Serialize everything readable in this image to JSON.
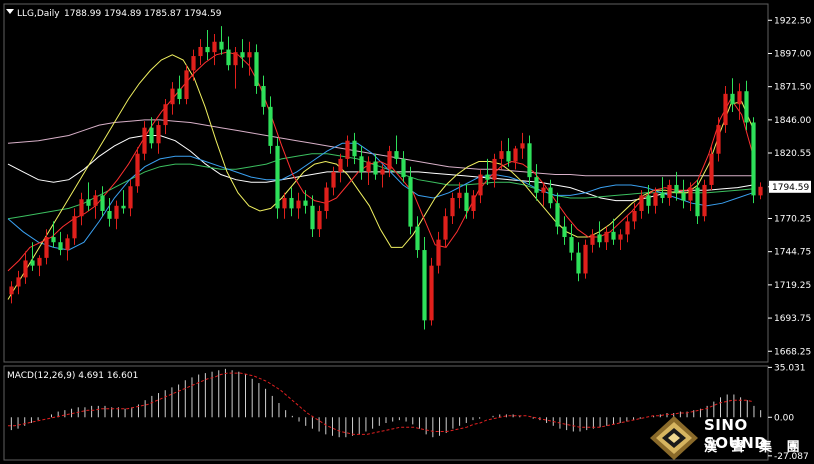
{
  "header": {
    "symbol": "LLG,Daily",
    "ohlc": "1788.99 1794.89 1785.87 1794.59",
    "menu_icon": "triangle-down-icon"
  },
  "macd_label": "MACD(12,26,9) 4.691 16.601",
  "brand": {
    "name": "SINO SOUND",
    "chinese": "漢 聲 集 團",
    "logo_icon": "diamond-logo-icon"
  },
  "colors": {
    "up_candle": "#e0201c",
    "down_candle": "#2ee05a",
    "ma_yellow": "#f0f060",
    "ma_fast_red": "#ff3030",
    "ma_white": "#ffffff",
    "ma_blue": "#3aa0f0",
    "ma_green": "#3cc060",
    "ma_pink": "#d8b0c8",
    "macd_hist": "#d0d0d0",
    "macd_signal": "#e02020",
    "current_price_box": "#ffffff"
  },
  "chart_data": [
    {
      "type": "candlestick",
      "title": "LLG,Daily",
      "current_price": 1794.59,
      "ylim": [
        1660,
        1935
      ],
      "y_ticks": [
        "1922.50",
        "1897.00",
        "1871.50",
        "1846.00",
        "1820.55",
        "1794.59",
        "1770.25",
        "1744.75",
        "1719.25",
        "1693.75",
        "1668.25"
      ],
      "y_tick_values": [
        1922.5,
        1897.0,
        1871.5,
        1846.0,
        1820.55,
        1794.59,
        1770.25,
        1744.75,
        1719.25,
        1693.75,
        1668.25
      ],
      "candles": [
        [
          1712,
          1722,
          1705,
          1718
        ],
        [
          1718,
          1730,
          1712,
          1725
        ],
        [
          1725,
          1745,
          1720,
          1738
        ],
        [
          1738,
          1752,
          1730,
          1734
        ],
        [
          1734,
          1742,
          1726,
          1740
        ],
        [
          1740,
          1762,
          1735,
          1756
        ],
        [
          1756,
          1768,
          1748,
          1752
        ],
        [
          1752,
          1760,
          1742,
          1746
        ],
        [
          1746,
          1758,
          1738,
          1755
        ],
        [
          1755,
          1778,
          1750,
          1772
        ],
        [
          1772,
          1790,
          1765,
          1785
        ],
        [
          1785,
          1798,
          1776,
          1780
        ],
        [
          1780,
          1792,
          1770,
          1788
        ],
        [
          1788,
          1795,
          1772,
          1776
        ],
        [
          1776,
          1786,
          1764,
          1770
        ],
        [
          1770,
          1784,
          1762,
          1780
        ],
        [
          1780,
          1792,
          1774,
          1778
        ],
        [
          1778,
          1800,
          1772,
          1795
        ],
        [
          1795,
          1825,
          1790,
          1820
        ],
        [
          1820,
          1845,
          1815,
          1840
        ],
        [
          1840,
          1848,
          1824,
          1828
        ],
        [
          1828,
          1845,
          1820,
          1842
        ],
        [
          1842,
          1862,
          1835,
          1858
        ],
        [
          1858,
          1875,
          1850,
          1870
        ],
        [
          1870,
          1880,
          1858,
          1862
        ],
        [
          1862,
          1888,
          1858,
          1884
        ],
        [
          1884,
          1900,
          1876,
          1895
        ],
        [
          1895,
          1908,
          1888,
          1902
        ],
        [
          1902,
          1915,
          1892,
          1898
        ],
        [
          1898,
          1912,
          1888,
          1906
        ],
        [
          1906,
          1918,
          1896,
          1900
        ],
        [
          1900,
          1910,
          1884,
          1888
        ],
        [
          1888,
          1902,
          1870,
          1898
        ],
        [
          1898,
          1908,
          1886,
          1894
        ],
        [
          1894,
          1906,
          1880,
          1898
        ],
        [
          1898,
          1904,
          1866,
          1872
        ],
        [
          1872,
          1880,
          1850,
          1856
        ],
        [
          1856,
          1864,
          1820,
          1826
        ],
        [
          1826,
          1832,
          1770,
          1778
        ],
        [
          1778,
          1790,
          1770,
          1786
        ],
        [
          1786,
          1794,
          1772,
          1778
        ],
        [
          1778,
          1790,
          1770,
          1784
        ],
        [
          1784,
          1792,
          1774,
          1780
        ],
        [
          1780,
          1788,
          1756,
          1762
        ],
        [
          1762,
          1780,
          1756,
          1776
        ],
        [
          1776,
          1798,
          1770,
          1794
        ],
        [
          1794,
          1810,
          1788,
          1806
        ],
        [
          1806,
          1820,
          1798,
          1816
        ],
        [
          1816,
          1834,
          1810,
          1830
        ],
        [
          1830,
          1836,
          1812,
          1818
        ],
        [
          1818,
          1826,
          1800,
          1806
        ],
        [
          1806,
          1818,
          1796,
          1814
        ],
        [
          1814,
          1820,
          1800,
          1804
        ],
        [
          1804,
          1812,
          1794,
          1808
        ],
        [
          1808,
          1826,
          1802,
          1822
        ],
        [
          1822,
          1834,
          1812,
          1816
        ],
        [
          1816,
          1822,
          1798,
          1802
        ],
        [
          1802,
          1810,
          1758,
          1764
        ],
        [
          1764,
          1772,
          1740,
          1746
        ],
        [
          1746,
          1756,
          1685,
          1692
        ],
        [
          1692,
          1740,
          1688,
          1734
        ],
        [
          1734,
          1760,
          1728,
          1754
        ],
        [
          1754,
          1778,
          1748,
          1772
        ],
        [
          1772,
          1790,
          1766,
          1786
        ],
        [
          1786,
          1798,
          1778,
          1790
        ],
        [
          1790,
          1796,
          1770,
          1776
        ],
        [
          1776,
          1792,
          1770,
          1788
        ],
        [
          1788,
          1808,
          1782,
          1804
        ],
        [
          1804,
          1816,
          1796,
          1800
        ],
        [
          1800,
          1820,
          1794,
          1816
        ],
        [
          1816,
          1830,
          1808,
          1822
        ],
        [
          1822,
          1832,
          1810,
          1814
        ],
        [
          1814,
          1826,
          1808,
          1824
        ],
        [
          1824,
          1836,
          1816,
          1828
        ],
        [
          1828,
          1834,
          1796,
          1802
        ],
        [
          1802,
          1812,
          1784,
          1790
        ],
        [
          1790,
          1798,
          1780,
          1794
        ],
        [
          1794,
          1800,
          1778,
          1782
        ],
        [
          1782,
          1790,
          1758,
          1764
        ],
        [
          1764,
          1772,
          1750,
          1756
        ],
        [
          1756,
          1766,
          1738,
          1744
        ],
        [
          1744,
          1752,
          1722,
          1728
        ],
        [
          1728,
          1754,
          1724,
          1750
        ],
        [
          1750,
          1762,
          1744,
          1758
        ],
        [
          1758,
          1768,
          1748,
          1752
        ],
        [
          1752,
          1764,
          1746,
          1760
        ],
        [
          1760,
          1770,
          1750,
          1754
        ],
        [
          1754,
          1762,
          1746,
          1758
        ],
        [
          1758,
          1772,
          1752,
          1768
        ],
        [
          1768,
          1782,
          1762,
          1776
        ],
        [
          1776,
          1792,
          1770,
          1788
        ],
        [
          1788,
          1796,
          1774,
          1780
        ],
        [
          1780,
          1794,
          1774,
          1790
        ],
        [
          1790,
          1802,
          1782,
          1786
        ],
        [
          1786,
          1800,
          1780,
          1796
        ],
        [
          1796,
          1806,
          1784,
          1790
        ],
        [
          1790,
          1800,
          1778,
          1784
        ],
        [
          1784,
          1798,
          1776,
          1794
        ],
        [
          1794,
          1800,
          1766,
          1772
        ],
        [
          1772,
          1800,
          1768,
          1796
        ],
        [
          1796,
          1826,
          1792,
          1820
        ],
        [
          1820,
          1848,
          1814,
          1842
        ],
        [
          1842,
          1872,
          1836,
          1866
        ],
        [
          1866,
          1878,
          1852,
          1858
        ],
        [
          1858,
          1874,
          1846,
          1868
        ],
        [
          1868,
          1876,
          1838,
          1844
        ],
        [
          1844,
          1848,
          1782,
          1788
        ],
        [
          1788,
          1798,
          1785,
          1794.59
        ]
      ],
      "ma_fast_red": [
        1730,
        1738,
        1748,
        1752,
        1756,
        1764,
        1770,
        1774,
        1780,
        1790,
        1800,
        1812,
        1826,
        1840,
        1852,
        1862,
        1872,
        1882,
        1890,
        1896,
        1898,
        1896,
        1888,
        1872,
        1850,
        1826,
        1804,
        1790,
        1784,
        1782,
        1786,
        1796,
        1806,
        1812,
        1814,
        1810,
        1800,
        1790,
        1770,
        1750,
        1748,
        1760,
        1776,
        1792,
        1802,
        1810,
        1814,
        1812,
        1806,
        1796,
        1784,
        1772,
        1762,
        1756,
        1756,
        1760,
        1768,
        1776,
        1786,
        1792,
        1794,
        1792,
        1792,
        1800,
        1820,
        1846,
        1862,
        1850,
        1820
      ],
      "ma_yellow": [
        1708,
        1722,
        1736,
        1750,
        1764,
        1778,
        1792,
        1806,
        1820,
        1834,
        1848,
        1862,
        1874,
        1884,
        1892,
        1896,
        1892,
        1878,
        1856,
        1830,
        1806,
        1790,
        1780,
        1776,
        1778,
        1786,
        1796,
        1806,
        1812,
        1814,
        1812,
        1804,
        1792,
        1780,
        1762,
        1748,
        1748,
        1758,
        1772,
        1786,
        1796,
        1804,
        1810,
        1814,
        1814,
        1812,
        1806,
        1798,
        1788,
        1778,
        1768,
        1760,
        1756,
        1756,
        1760,
        1766,
        1774,
        1782,
        1788,
        1792,
        1792,
        1790,
        1790,
        1796,
        1812,
        1836,
        1858,
        1860,
        1840
      ],
      "ma_white": [
        1812,
        1806,
        1800,
        1798,
        1800,
        1808,
        1818,
        1826,
        1832,
        1834,
        1834,
        1830,
        1822,
        1812,
        1804,
        1800,
        1798,
        1798,
        1800,
        1802,
        1804,
        1806,
        1806,
        1806,
        1806,
        1806,
        1806,
        1806,
        1805,
        1804,
        1803,
        1802,
        1801,
        1800,
        1799,
        1798,
        1796,
        1794,
        1790,
        1786,
        1784,
        1784,
        1786,
        1789,
        1791,
        1792,
        1792,
        1793,
        1794,
        1796
      ],
      "ma_blue": [
        1770,
        1760,
        1752,
        1748,
        1746,
        1752,
        1768,
        1786,
        1800,
        1810,
        1816,
        1818,
        1818,
        1814,
        1810,
        1806,
        1802,
        1800,
        1800,
        1806,
        1814,
        1822,
        1828,
        1828,
        1820,
        1808,
        1796,
        1788,
        1786,
        1790,
        1796,
        1802,
        1804,
        1802,
        1798,
        1792,
        1788,
        1788,
        1790,
        1794,
        1796,
        1796,
        1794,
        1790,
        1786,
        1782,
        1780,
        1782,
        1786,
        1790
      ],
      "ma_green": [
        1770,
        1772,
        1774,
        1776,
        1778,
        1782,
        1788,
        1794,
        1800,
        1806,
        1810,
        1812,
        1812,
        1810,
        1808,
        1808,
        1810,
        1812,
        1816,
        1818,
        1820,
        1820,
        1818,
        1816,
        1812,
        1808,
        1804,
        1800,
        1798,
        1796,
        1796,
        1797,
        1798,
        1798,
        1796,
        1792,
        1788,
        1786,
        1786,
        1787,
        1788,
        1789,
        1790,
        1790,
        1790,
        1790,
        1790,
        1791,
        1792,
        1793
      ],
      "ma_pink": [
        1828,
        1829,
        1830,
        1832,
        1834,
        1838,
        1842,
        1844,
        1845,
        1846,
        1846,
        1845,
        1844,
        1842,
        1840,
        1838,
        1836,
        1834,
        1832,
        1830,
        1828,
        1826,
        1824,
        1822,
        1820,
        1818,
        1816,
        1814,
        1812,
        1810,
        1809,
        1808,
        1808,
        1807,
        1806,
        1805,
        1804,
        1804,
        1803,
        1803,
        1803,
        1803,
        1803,
        1803,
        1803,
        1803,
        1803,
        1803,
        1803,
        1803
      ]
    },
    {
      "type": "bar",
      "title": "MACD(12,26,9) 4.691 16.601",
      "ylim": [
        -30,
        36
      ],
      "y_ticks": [
        "35.031",
        "0.00",
        "-27.087"
      ],
      "y_tick_values": [
        35.031,
        0,
        -27.087
      ],
      "macd_hist": [
        -9,
        -8,
        -6,
        -4,
        -2,
        0,
        2,
        4,
        5,
        6,
        7,
        7,
        8,
        8,
        8,
        7,
        7,
        6,
        7,
        9,
        12,
        15,
        17,
        19,
        21,
        23,
        26,
        28,
        30,
        31,
        32,
        33,
        34,
        33,
        32,
        30,
        27,
        24,
        20,
        15,
        10,
        5,
        1,
        -3,
        -6,
        -8,
        -10,
        -12,
        -13,
        -14,
        -14,
        -13,
        -12,
        -10,
        -8,
        -6,
        -4,
        -3,
        -2,
        -3,
        -5,
        -8,
        -12,
        -14,
        -13,
        -11,
        -8,
        -6,
        -4,
        -2,
        -1,
        0,
        1,
        2,
        2,
        2,
        1,
        0,
        -1,
        -2,
        -4,
        -6,
        -8,
        -9,
        -10,
        -10,
        -9,
        -8,
        -7,
        -6,
        -5,
        -4,
        -3,
        -2,
        -1,
        0,
        1,
        2,
        3,
        3,
        4,
        4,
        5,
        6,
        8,
        11,
        14,
        16,
        16,
        14,
        12,
        8,
        5
      ],
      "macd_signal": [
        -6,
        -6,
        -5,
        -4,
        -3,
        -2,
        -1,
        0,
        1,
        2,
        3,
        4,
        5,
        5,
        6,
        6,
        6,
        6,
        6,
        7,
        8,
        9,
        11,
        13,
        15,
        17,
        19,
        21,
        23,
        25,
        27,
        28,
        30,
        31,
        31,
        31,
        30,
        29,
        27,
        25,
        22,
        19,
        15,
        11,
        7,
        3,
        0,
        -3,
        -6,
        -8,
        -10,
        -11,
        -12,
        -12,
        -12,
        -11,
        -10,
        -9,
        -8,
        -7,
        -7,
        -7,
        -8,
        -9,
        -10,
        -10,
        -10,
        -9,
        -8,
        -7,
        -5,
        -4,
        -2,
        -1,
        0,
        1,
        1,
        1,
        1,
        0,
        -1,
        -2,
        -3,
        -4,
        -5,
        -6,
        -7,
        -7,
        -7,
        -7,
        -6,
        -5,
        -4,
        -3,
        -2,
        -1,
        0,
        1,
        1,
        2,
        2,
        3,
        3,
        4,
        5,
        6,
        8,
        10,
        11,
        12,
        12,
        12,
        11
      ]
    }
  ]
}
